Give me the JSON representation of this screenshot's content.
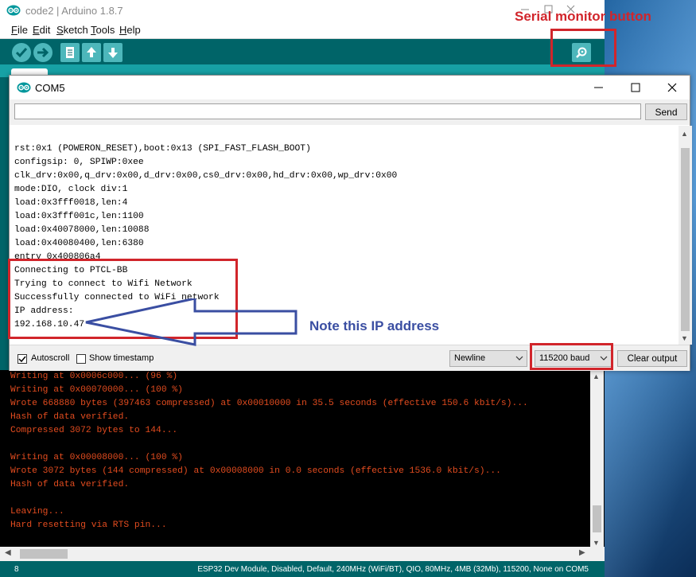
{
  "ide": {
    "title": "code2 | Arduino 1.8.7",
    "menu": [
      "File",
      "Edit",
      "Sketch",
      "Tools",
      "Help"
    ],
    "menu_underline": [
      "F",
      "E",
      "S",
      "T",
      "H"
    ],
    "console_lines": [
      "Writing at 0x0006c000... (96 %)",
      "Writing at 0x00070000... (100 %)",
      "Wrote 668880 bytes (397463 compressed) at 0x00010000 in 35.5 seconds (effective 150.6 kbit/s)...",
      "Hash of data verified.",
      "Compressed 3072 bytes to 144...",
      "",
      "Writing at 0x00008000... (100 %)",
      "Wrote 3072 bytes (144 compressed) at 0x00008000 in 0.0 seconds (effective 1536.0 kbit/s)...",
      "Hash of data verified.",
      "",
      "Leaving...",
      "Hard resetting via RTS pin..."
    ],
    "status_line_number": "8",
    "status_board": "ESP32 Dev Module, Disabled, Default, 240MHz (WiFi/BT), QIO, 80MHz, 4MB (32Mb), 115200, None on COM5",
    "teal": "#006468",
    "console_text_color": "#e34c1f"
  },
  "serial_monitor": {
    "title": "COM5",
    "input_value": "",
    "send_label": "Send",
    "output_lines": [
      "rst:0x1 (POWERON_RESET),boot:0x13 (SPI_FAST_FLASH_BOOT)",
      "configsip: 0, SPIWP:0xee",
      "clk_drv:0x00,q_drv:0x00,d_drv:0x00,cs0_drv:0x00,hd_drv:0x00,wp_drv:0x00",
      "mode:DIO, clock div:1",
      "load:0x3fff0018,len:4",
      "load:0x3fff001c,len:1100",
      "load:0x40078000,len:10088",
      "load:0x40080400,len:6380",
      "entry 0x400806a4",
      "Connecting to PTCL-BB",
      "Trying to connect to Wifi Network",
      "Successfully connected to WiFi network",
      "IP address:",
      "192.168.10.47"
    ],
    "autoscroll_label": "Autoscroll",
    "autoscroll_checked": true,
    "timestamp_label": "Show timestamp",
    "timestamp_checked": false,
    "line_ending": "Newline",
    "baud": "115200 baud",
    "clear_label": "Clear output"
  },
  "annotations": {
    "serial_monitor_label": "Serial monitor button",
    "ip_note": "Note this IP address",
    "red": "#d1252b",
    "blue": "#3a4ea2"
  }
}
